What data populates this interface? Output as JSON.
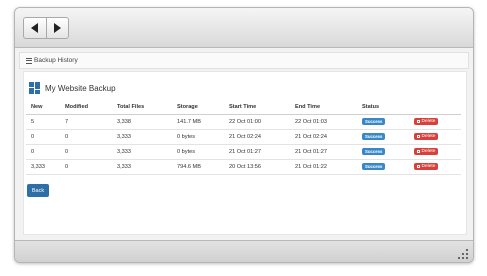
{
  "toolbar": {
    "back_icon": "back-arrow-icon",
    "forward_icon": "forward-arrow-icon"
  },
  "breadcrumb": {
    "icon": "list-icon",
    "label": "Backup History"
  },
  "panel": {
    "icon": "website-backup-icon",
    "title": "My Website Backup"
  },
  "table": {
    "columns": [
      "New",
      "Modified",
      "Total Files",
      "Storage",
      "Start Time",
      "End Time",
      "Status",
      ""
    ],
    "rows": [
      {
        "new": "5",
        "modified": "7",
        "total_files": "3,338",
        "storage": "141.7 MB",
        "start_time": "22 Oct 01:00",
        "end_time": "22 Oct 01:03",
        "status": "Success",
        "action": "Delete"
      },
      {
        "new": "0",
        "modified": "0",
        "total_files": "3,333",
        "storage": "0 bytes",
        "start_time": "21 Oct 02:24",
        "end_time": "21 Oct 02:24",
        "status": "Success",
        "action": "Delete"
      },
      {
        "new": "0",
        "modified": "0",
        "total_files": "3,333",
        "storage": "0 bytes",
        "start_time": "21 Oct 01:27",
        "end_time": "21 Oct 01:27",
        "status": "Success",
        "action": "Delete"
      },
      {
        "new": "3,333",
        "modified": "0",
        "total_files": "3,333",
        "storage": "794.6 MB",
        "start_time": "20 Oct 13:56",
        "end_time": "21 Oct 01:22",
        "status": "Success",
        "action": "Delete"
      }
    ]
  },
  "back_button": "Back",
  "colors": {
    "primary": "#2f6fa8",
    "success_badge": "#3a87c8",
    "danger": "#d8413b"
  }
}
